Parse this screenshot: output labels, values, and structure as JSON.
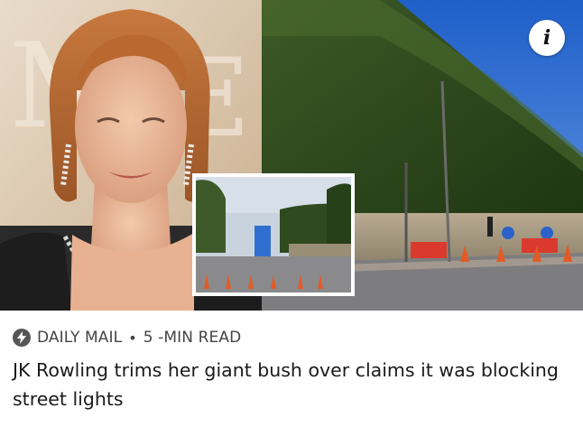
{
  "article": {
    "source": "DAILY MAIL",
    "separator": "•",
    "read_time": "5 -MIN READ",
    "headline": "JK Rowling trims her giant bush over claims it was blocking street lights",
    "info_label": "i"
  },
  "colors": {
    "hedge": "#2f4a1f",
    "sky": "#2f6fd0",
    "background_gold": "#d9c4a8",
    "meta_text": "#444444",
    "headline_text": "#1a1a1a"
  },
  "icons": [
    "bolt-icon",
    "info-icon"
  ]
}
